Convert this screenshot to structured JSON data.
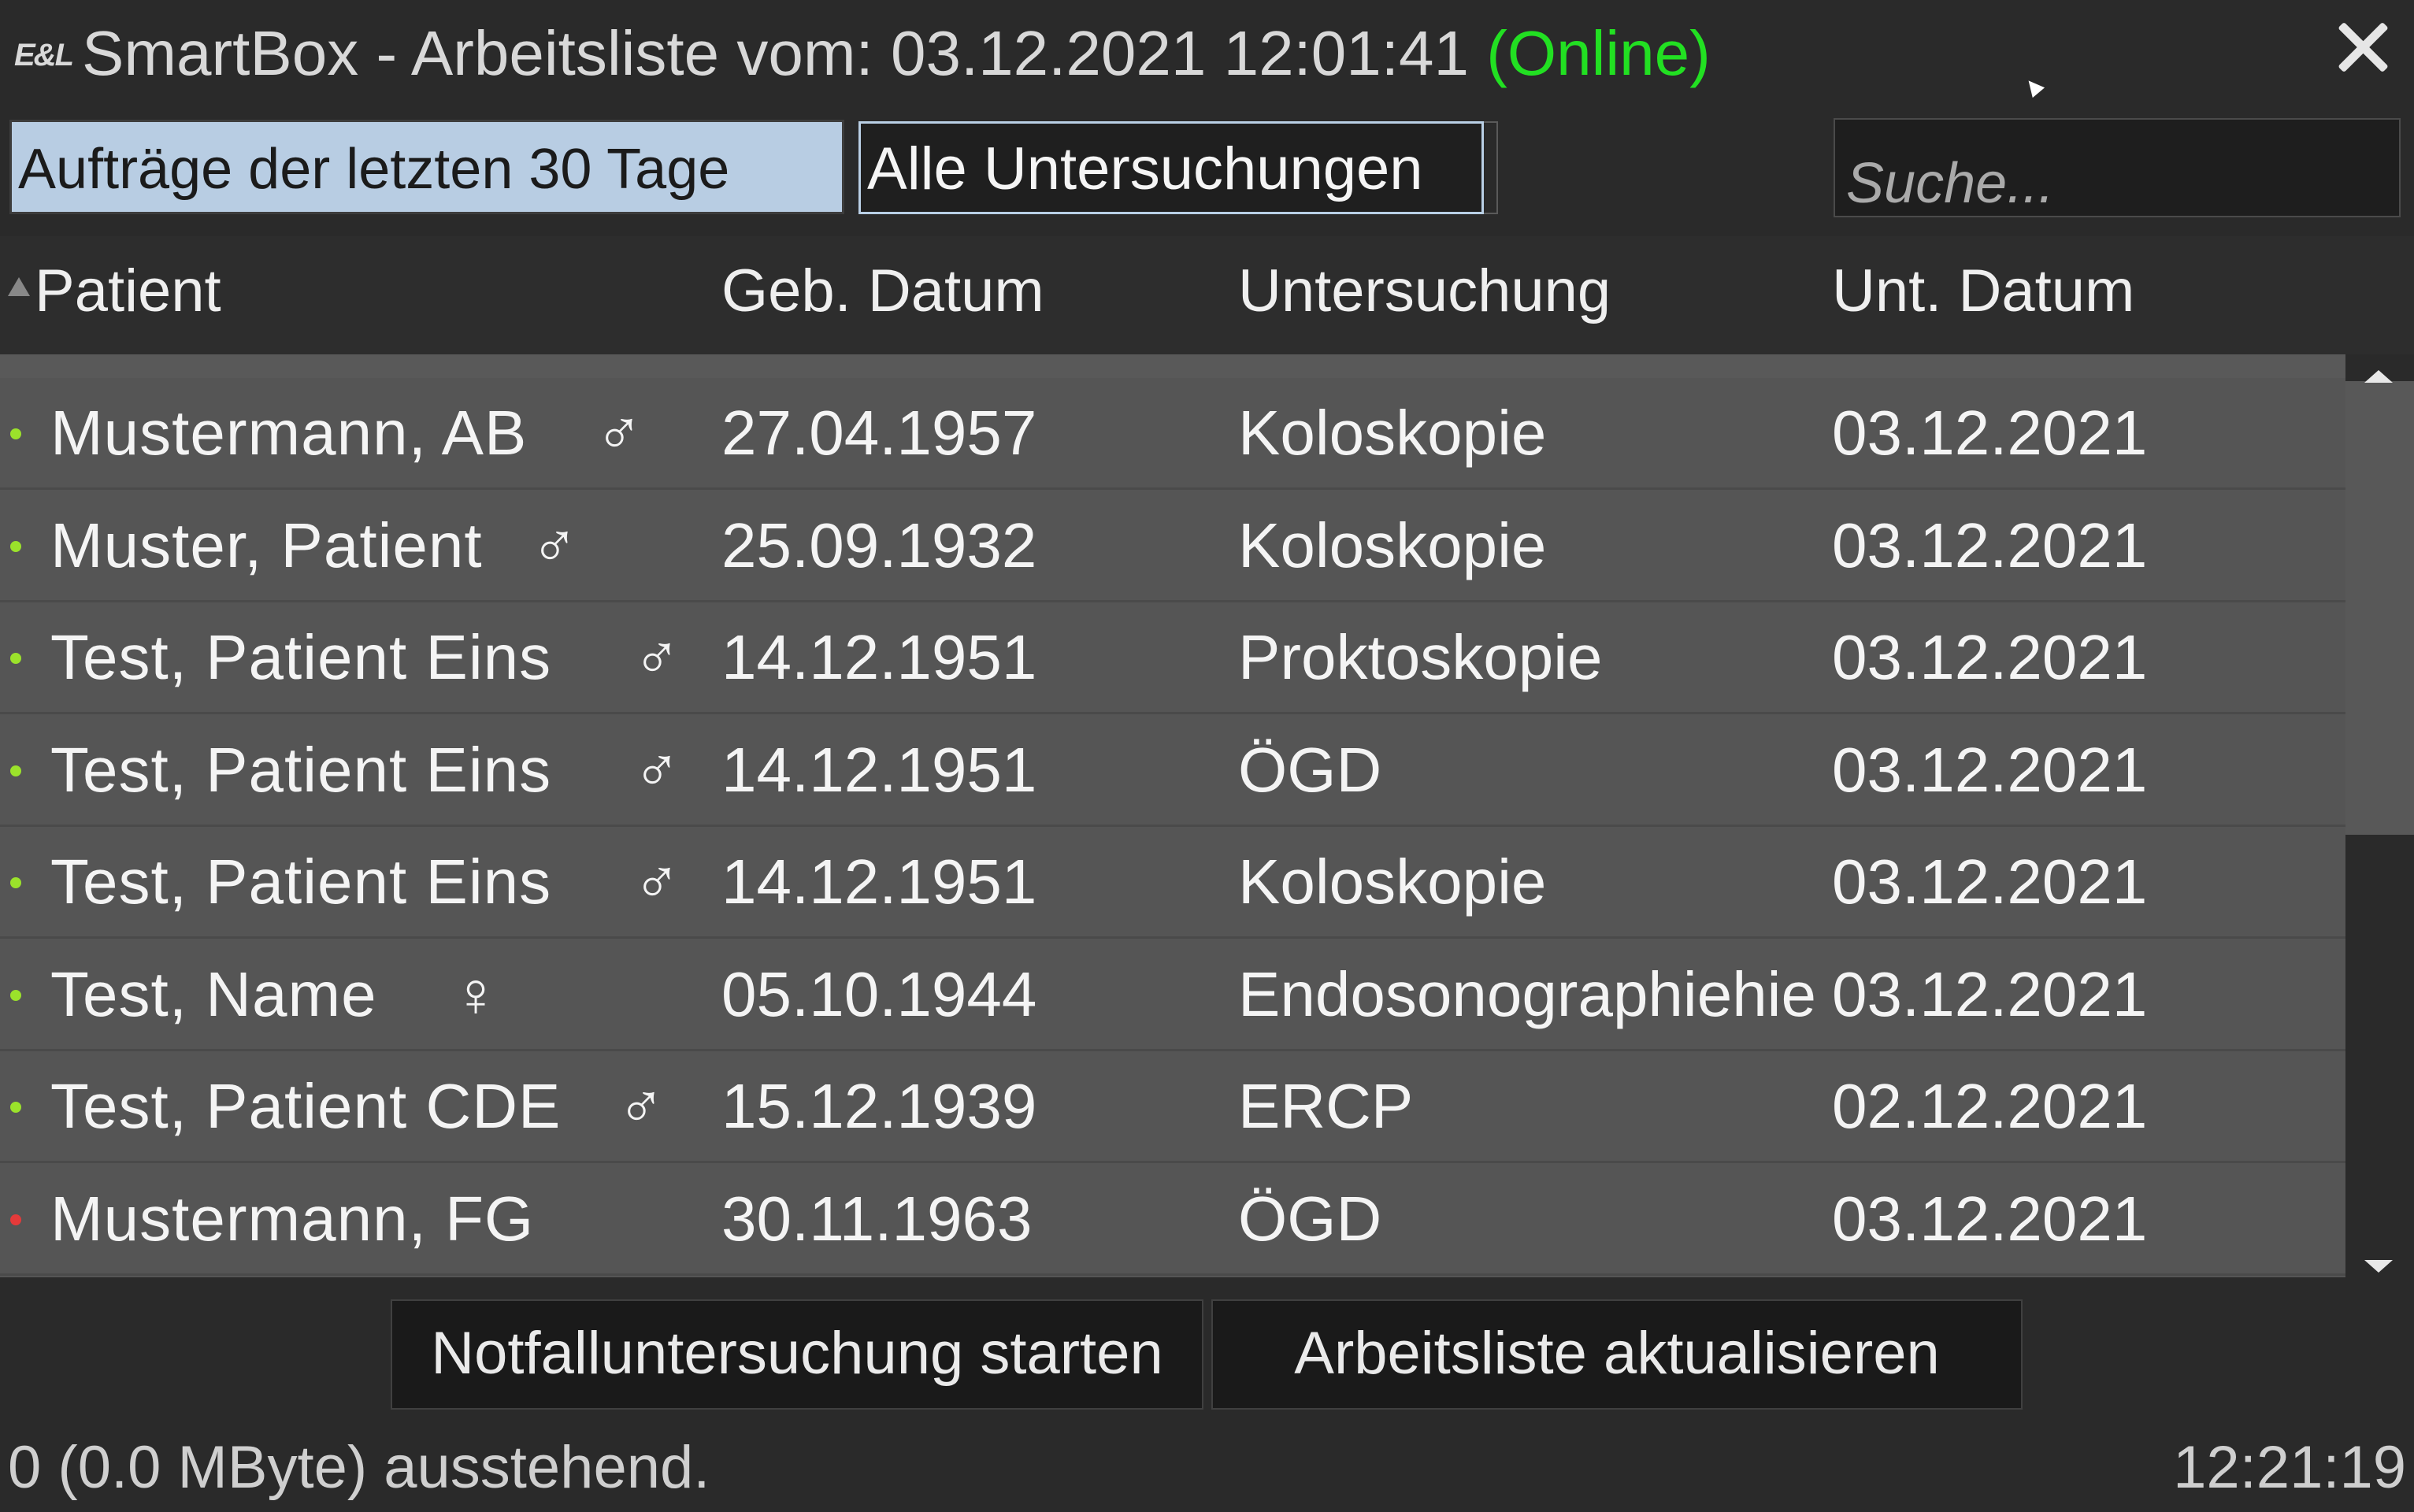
{
  "window": {
    "logo": "E&L",
    "title_prefix": "SmartBox - Arbeitsliste vom: 03.12.2021 12:01:41",
    "status": "(Online)",
    "close_icon": "close-x-icon"
  },
  "filters": {
    "period": "Aufträge der letzten 30 Tage",
    "exam_type": "Alle Untersuchungen",
    "search_placeholder": "Suche..."
  },
  "table": {
    "columns": [
      "Patient",
      "Geb. Datum",
      "Untersuchung",
      "Unt. Datum"
    ],
    "sort_icon": "sort-ascending-icon",
    "rows": [
      {
        "name": "Mustermann, AB",
        "sex": "♂",
        "dob": "27.04.1957",
        "exam": "Koloskopie",
        "date": "03.12.2021",
        "status_color": "#9be22b"
      },
      {
        "name": "Muster, Patient",
        "sex": "♂",
        "dob": "25.09.1932",
        "exam": "Koloskopie",
        "date": "03.12.2021",
        "status_color": "#9be22b"
      },
      {
        "name": "Test, Patient Eins",
        "sex": "♂",
        "dob": "14.12.1951",
        "exam": "Proktoskopie",
        "date": "03.12.2021",
        "status_color": "#9be22b"
      },
      {
        "name": "Test, Patient Eins",
        "sex": "♂",
        "dob": "14.12.1951",
        "exam": "ÖGD",
        "date": "03.12.2021",
        "status_color": "#9be22b"
      },
      {
        "name": "Test, Patient Eins",
        "sex": "♂",
        "dob": "14.12.1951",
        "exam": "Koloskopie",
        "date": "03.12.2021",
        "status_color": "#9be22b"
      },
      {
        "name": "Test, Name",
        "sex": "♀",
        "dob": "05.10.1944",
        "exam": "Endosonographiehie",
        "date": "03.12.2021",
        "status_color": "#9be22b"
      },
      {
        "name": "Test, Patient CDE",
        "sex": "♂",
        "dob": "15.12.1939",
        "exam": "ERCP",
        "date": "02.12.2021",
        "status_color": "#9be22b"
      },
      {
        "name": "Mustermann, FG",
        "sex": "",
        "dob": "30.11.1963",
        "exam": "ÖGD",
        "date": "03.12.2021",
        "status_color": "#e53a3a"
      }
    ]
  },
  "actions": {
    "emergency": "Notfalluntersuchung starten",
    "refresh": "Arbeitsliste aktualisieren"
  },
  "footer": {
    "status": "0 (0.0 MByte) ausstehend.",
    "clock": "12:21:19"
  },
  "colors": {
    "online": "#22e022",
    "selected_filter": "#b8cde3",
    "row_bg": "#555555",
    "window_bg": "#2a2a2a"
  }
}
